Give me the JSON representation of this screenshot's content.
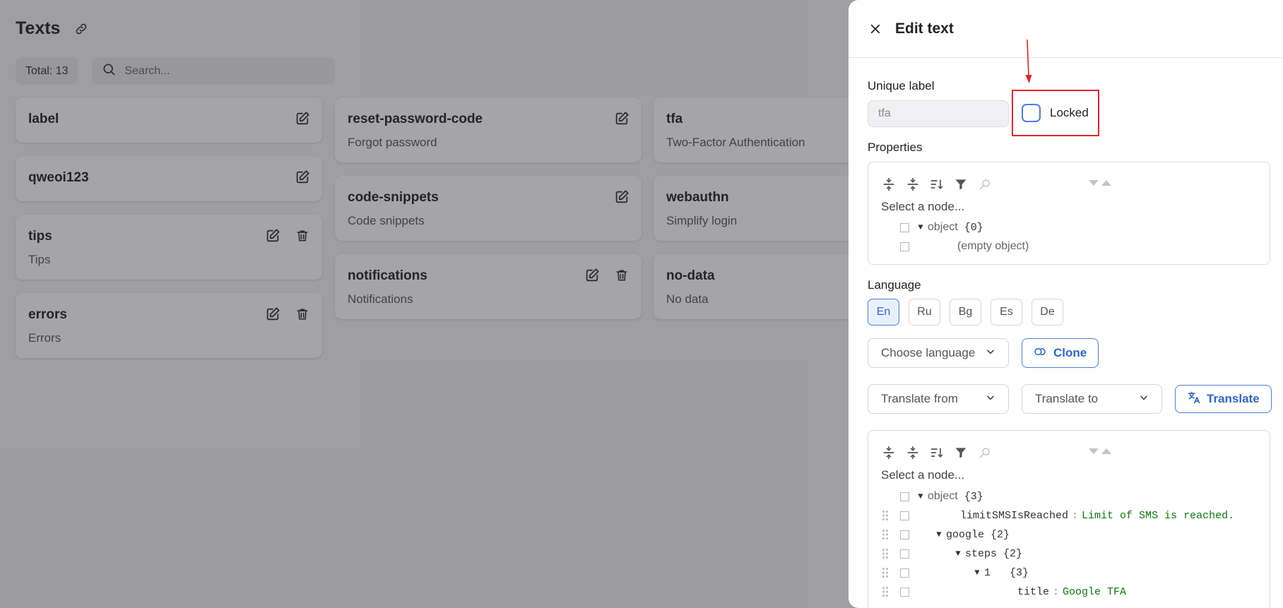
{
  "page": {
    "title": "Texts",
    "total_label": "Total: 13",
    "search_placeholder": "Search..."
  },
  "cards": {
    "col1": [
      {
        "title": "label",
        "subtitle": ""
      },
      {
        "title": "qweoi123",
        "subtitle": ""
      },
      {
        "title": "tips",
        "subtitle": "Tips"
      },
      {
        "title": "errors",
        "subtitle": "Errors"
      }
    ],
    "col2": [
      {
        "title": "reset-password-code",
        "subtitle": "Forgot password"
      },
      {
        "title": "code-snippets",
        "subtitle": "Code snippets"
      },
      {
        "title": "notifications",
        "subtitle": "Notifications"
      }
    ],
    "col3": [
      {
        "title": "tfa",
        "subtitle": "Two-Factor Authentication"
      },
      {
        "title": "webauthn",
        "subtitle": "Simplify login"
      },
      {
        "title": "no-data",
        "subtitle": "No data"
      }
    ]
  },
  "drawer": {
    "title": "Edit text",
    "unique_label": "Unique label",
    "unique_value": "tfa",
    "locked_label": "Locked",
    "locked_checked": false,
    "properties_label": "Properties",
    "properties_tree": {
      "select_placeholder": "Select a node...",
      "root_key": "object",
      "root_count": "{0}",
      "empty_text": "(empty object)"
    },
    "language_label": "Language",
    "languages": [
      "En",
      "Ru",
      "Bg",
      "Es",
      "De"
    ],
    "active_language": "En",
    "choose_language": "Choose language",
    "clone_label": "Clone",
    "translate_from": "Translate from",
    "translate_to": "Translate to",
    "translate_label": "Translate",
    "content_tree": {
      "select_placeholder": "Select a node...",
      "root_key": "object",
      "root_count": "{3}",
      "row1_key": "limitSMSIsReached",
      "row1_value": "Limit of SMS is reached.",
      "row2_key": "google",
      "row2_count": "{2}",
      "row3_key": "steps",
      "row3_count": "{2}",
      "row4_key": "1",
      "row4_count": "{3}",
      "row5_key": "title",
      "row5_value": "Google TFA"
    }
  },
  "colors": {
    "accent": "#2f66c8",
    "annotation": "#e0242b",
    "json_value": "#0b7a0b"
  }
}
